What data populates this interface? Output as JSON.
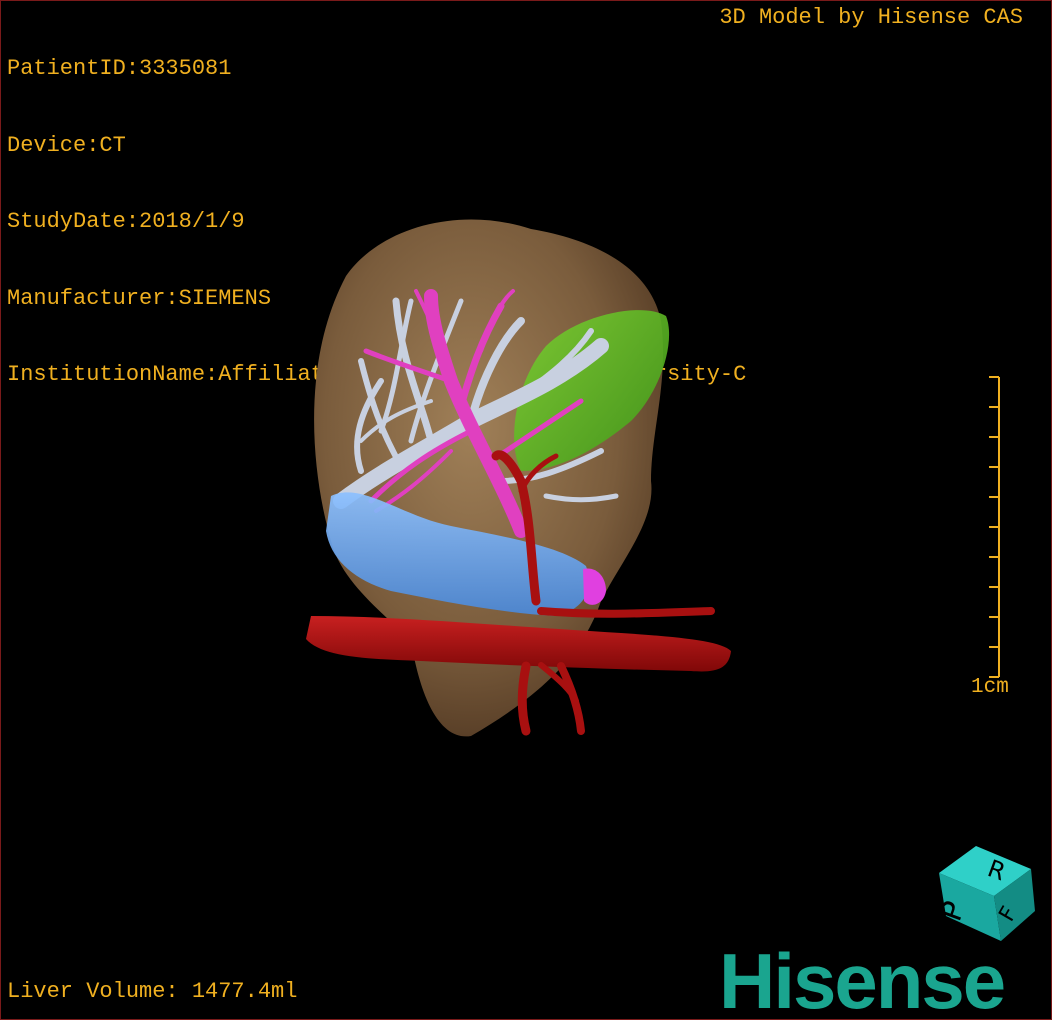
{
  "viewer": {
    "patient_id": "PatientID:3335081",
    "device": "Device:CT",
    "study_date": "StudyDate:2018/1/9",
    "manufacturer": "Manufacturer:SIEMENS",
    "institution": "InstitutionName:Affiliated Hospital Qingdao University-C",
    "credit": "3D Model by Hisense CAS",
    "liver_volume": "Liver Volume: 1477.4ml",
    "scale_label": "1cm"
  },
  "orientation_cube": {
    "faces": [
      "P",
      "R",
      "F"
    ]
  },
  "brand": {
    "logo_text": "Hisense"
  },
  "colors": {
    "overlay_text": "#f0b020",
    "liver": "#8a6a45",
    "hepatic_vein": "#c8d0e0",
    "portal_vein": "#e040c0",
    "artery": "#b01010",
    "gallbladder": "#5fc020",
    "vena_cava": "#6aa8f0",
    "logo": "#1aa58f"
  }
}
